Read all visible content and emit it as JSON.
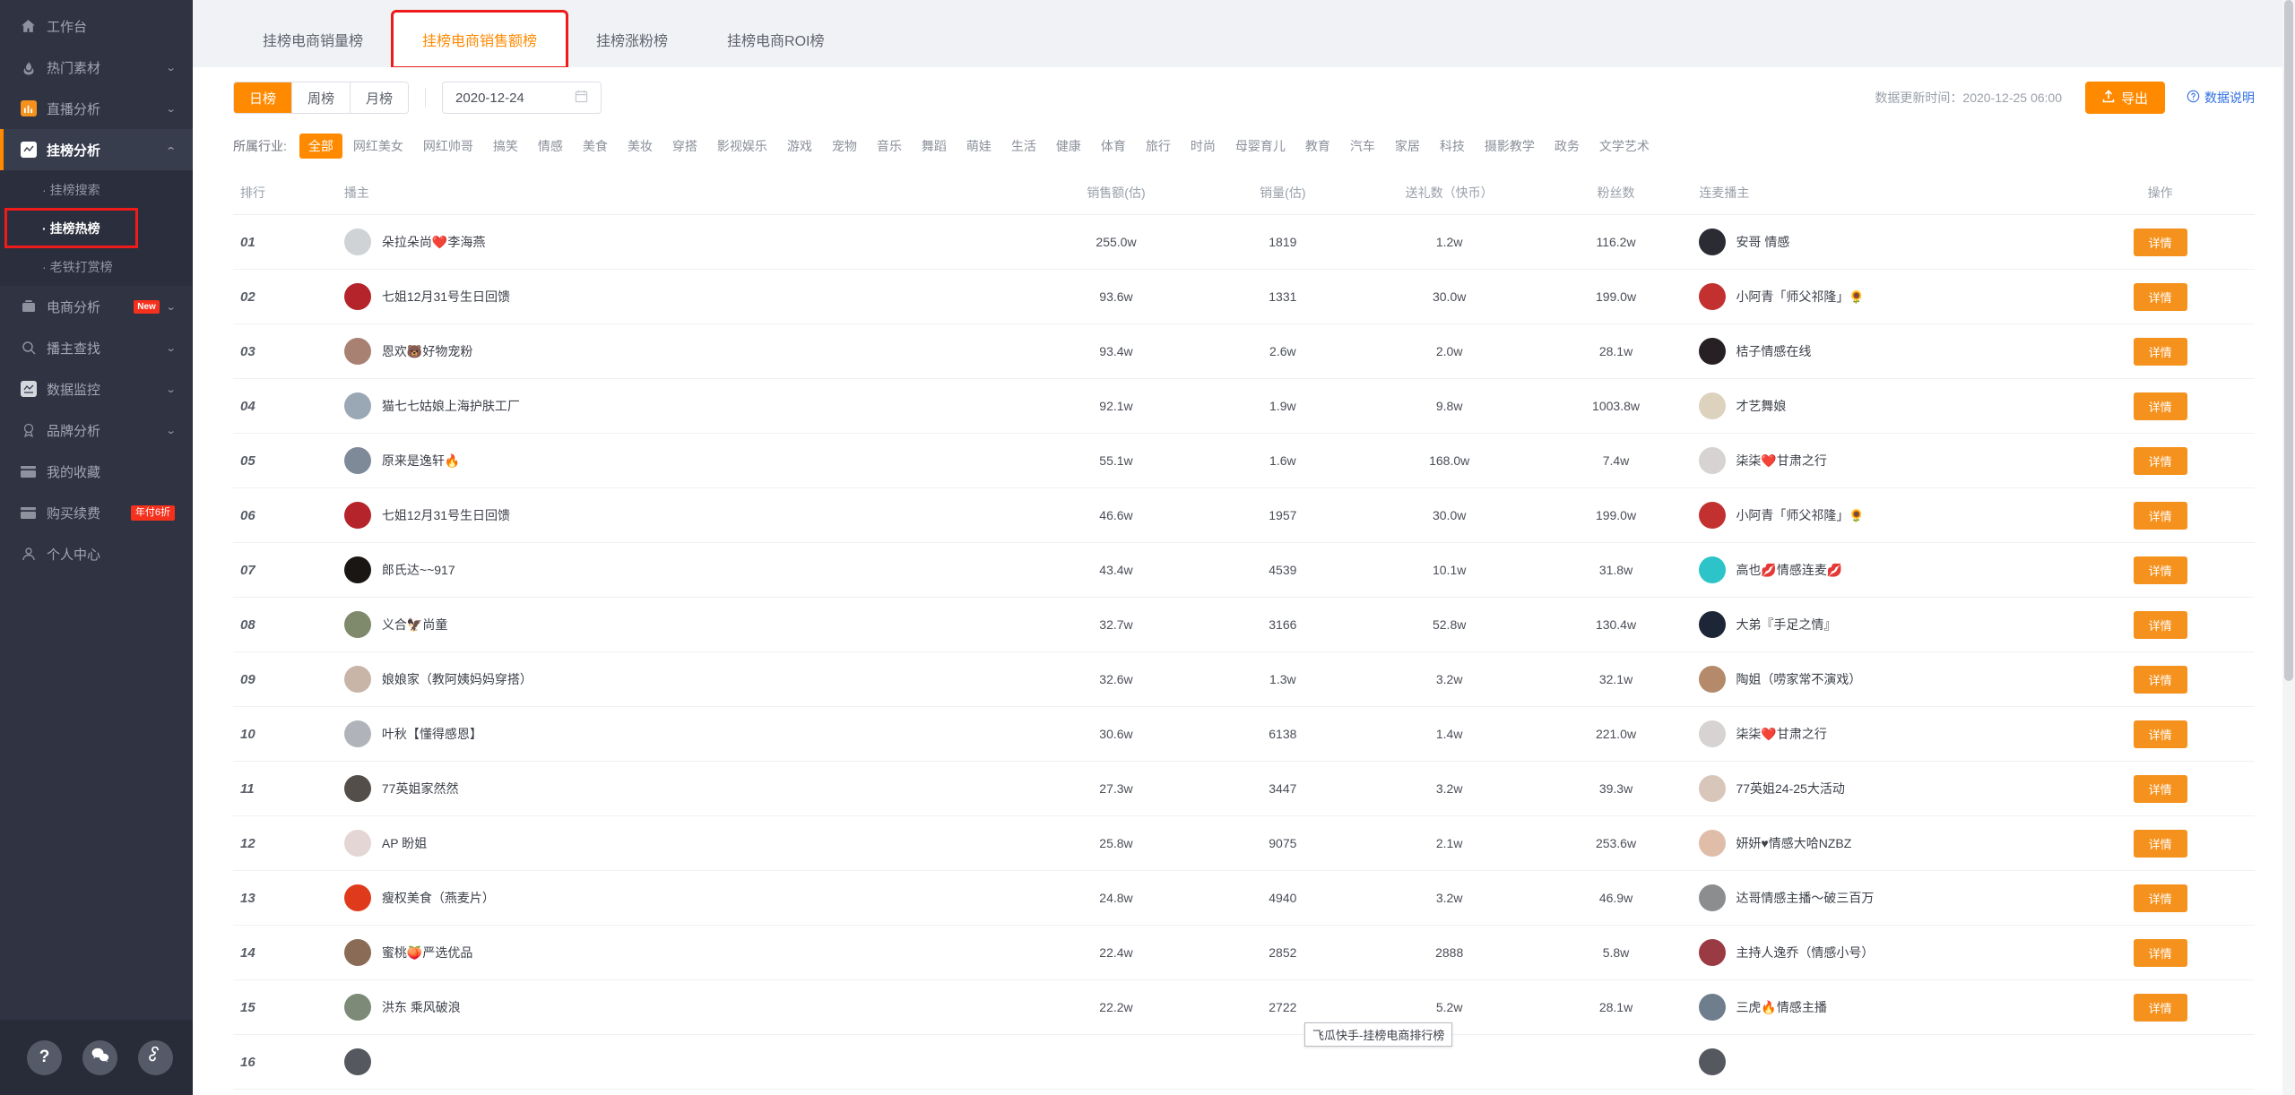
{
  "sidebar": {
    "items": [
      {
        "label": "工作台",
        "icon": "home-icon",
        "expandable": false,
        "active": false
      },
      {
        "label": "热门素材",
        "icon": "fire-icon",
        "expandable": true,
        "active": false
      },
      {
        "label": "直播分析",
        "icon": "bar-chart-icon",
        "expandable": true,
        "active": false
      },
      {
        "label": "挂榜分析",
        "icon": "line-chart-icon",
        "expandable": true,
        "active": true
      }
    ],
    "sub_items": [
      {
        "label": "挂榜搜索",
        "active": false,
        "highlight": false
      },
      {
        "label": "挂榜热榜",
        "active": true,
        "highlight": true
      },
      {
        "label": "老铁打赏榜",
        "active": false,
        "highlight": false
      }
    ],
    "items_after": [
      {
        "label": "电商分析",
        "icon": "briefcase-icon",
        "expandable": true,
        "badge": "New",
        "badge_type": "new"
      },
      {
        "label": "播主查找",
        "icon": "search-icon",
        "expandable": true
      },
      {
        "label": "数据监控",
        "icon": "monitor-icon",
        "expandable": true
      },
      {
        "label": "品牌分析",
        "icon": "medal-icon",
        "expandable": true
      },
      {
        "label": "我的收藏",
        "icon": "card-icon",
        "expandable": false
      },
      {
        "label": "购买续费",
        "icon": "card-icon",
        "expandable": false,
        "badge": "年付6折",
        "badge_type": "off"
      },
      {
        "label": "个人中心",
        "icon": "user-icon",
        "expandable": false
      }
    ],
    "footer_buttons": [
      {
        "name": "help-button",
        "glyph": "?"
      },
      {
        "name": "wechat-button",
        "glyph": "wechat"
      },
      {
        "name": "link-button",
        "glyph": "link"
      }
    ]
  },
  "tabs": [
    {
      "label": "挂榜电商销量榜",
      "active": false,
      "boxed": false
    },
    {
      "label": "挂榜电商销售额榜",
      "active": true,
      "boxed": true
    },
    {
      "label": "挂榜涨粉榜",
      "active": false,
      "boxed": false
    },
    {
      "label": "挂榜电商ROI榜",
      "active": false,
      "boxed": false
    }
  ],
  "filters": {
    "period_options": [
      {
        "label": "日榜",
        "selected": true
      },
      {
        "label": "周榜",
        "selected": false
      },
      {
        "label": "月榜",
        "selected": false
      }
    ],
    "date_value": "2020-12-24",
    "calendar_icon": "calendar-icon",
    "update_time": "数据更新时间：2020-12-25 06:00",
    "export_label": "导出",
    "export_icon": "upload-icon",
    "help_label": "数据说明",
    "help_icon": "question-circle-icon",
    "industry_label": "所属行业:",
    "industries": [
      {
        "label": "全部",
        "selected": true
      },
      {
        "label": "网红美女",
        "selected": false
      },
      {
        "label": "网红帅哥",
        "selected": false
      },
      {
        "label": "搞笑",
        "selected": false
      },
      {
        "label": "情感",
        "selected": false
      },
      {
        "label": "美食",
        "selected": false
      },
      {
        "label": "美妆",
        "selected": false
      },
      {
        "label": "穿搭",
        "selected": false
      },
      {
        "label": "影视娱乐",
        "selected": false
      },
      {
        "label": "游戏",
        "selected": false
      },
      {
        "label": "宠物",
        "selected": false
      },
      {
        "label": "音乐",
        "selected": false
      },
      {
        "label": "舞蹈",
        "selected": false
      },
      {
        "label": "萌娃",
        "selected": false
      },
      {
        "label": "生活",
        "selected": false
      },
      {
        "label": "健康",
        "selected": false
      },
      {
        "label": "体育",
        "selected": false
      },
      {
        "label": "旅行",
        "selected": false
      },
      {
        "label": "时尚",
        "selected": false
      },
      {
        "label": "母婴育儿",
        "selected": false
      },
      {
        "label": "教育",
        "selected": false
      },
      {
        "label": "汽车",
        "selected": false
      },
      {
        "label": "家居",
        "selected": false
      },
      {
        "label": "科技",
        "selected": false
      },
      {
        "label": "摄影教学",
        "selected": false
      },
      {
        "label": "政务",
        "selected": false
      },
      {
        "label": "文学艺术",
        "selected": false
      }
    ]
  },
  "table": {
    "columns": [
      "排行",
      "播主",
      "销售额(估)",
      "销量(估)",
      "送礼数（快币）",
      "粉丝数",
      "连麦播主",
      "操作"
    ],
    "action_label": "详情",
    "rows": [
      {
        "rank": "01",
        "host": "朵拉朵尚❤️李海燕",
        "avatar": "#cfd3d6",
        "sales": "255.0w",
        "volume": "1819",
        "gifts": "1.2w",
        "fans": "116.2w",
        "cohost": "安哥 情感",
        "cohost_avatar": "#2b2b33"
      },
      {
        "rank": "02",
        "host": "七姐12月31号生日回馈",
        "avatar": "#b5232b",
        "sales": "93.6w",
        "volume": "1331",
        "gifts": "30.0w",
        "fans": "199.0w",
        "cohost": "小阿青「师父祁隆」🌻",
        "cohost_avatar": "#c2312f"
      },
      {
        "rank": "03",
        "host": "恩欢🐻好物宠粉",
        "avatar": "#a88172",
        "sales": "93.4w",
        "volume": "2.6w",
        "gifts": "2.0w",
        "fans": "28.1w",
        "cohost": "桔子情感在线",
        "cohost_avatar": "#262024"
      },
      {
        "rank": "04",
        "host": "猫七七姑娘上海护肤工厂",
        "avatar": "#9aa7b4",
        "sales": "92.1w",
        "volume": "1.9w",
        "gifts": "9.8w",
        "fans": "1003.8w",
        "cohost": "才艺舞娘",
        "cohost_avatar": "#ddd2bd"
      },
      {
        "rank": "05",
        "host": "原来是逸轩🔥",
        "avatar": "#7f8a99",
        "sales": "55.1w",
        "volume": "1.6w",
        "gifts": "168.0w",
        "fans": "7.4w",
        "cohost": "柒柒❤️甘肃之行",
        "cohost_avatar": "#d6d3d2"
      },
      {
        "rank": "06",
        "host": "七姐12月31号生日回馈",
        "avatar": "#b5232b",
        "sales": "46.6w",
        "volume": "1957",
        "gifts": "30.0w",
        "fans": "199.0w",
        "cohost": "小阿青「师父祁隆」🌻",
        "cohost_avatar": "#c2312f"
      },
      {
        "rank": "07",
        "host": "郎氏达~~917",
        "avatar": "#191614",
        "sales": "43.4w",
        "volume": "4539",
        "gifts": "10.1w",
        "fans": "31.8w",
        "cohost": "高也💋情感连麦💋",
        "cohost_avatar": "#2cc4c9"
      },
      {
        "rank": "08",
        "host": "义合🦅尚童",
        "avatar": "#7e8a6b",
        "sales": "32.7w",
        "volume": "3166",
        "gifts": "52.8w",
        "fans": "130.4w",
        "cohost": "大弟『手足之情』",
        "cohost_avatar": "#1d2636"
      },
      {
        "rank": "09",
        "host": "娘娘家（教阿姨妈妈穿搭）",
        "avatar": "#c8b5a8",
        "sales": "32.6w",
        "volume": "1.3w",
        "gifts": "3.2w",
        "fans": "32.1w",
        "cohost": "陶姐（唠家常不演戏）",
        "cohost_avatar": "#b48a6b"
      },
      {
        "rank": "10",
        "host": "叶秋【懂得感恩】",
        "avatar": "#b0b4ba",
        "sales": "30.6w",
        "volume": "6138",
        "gifts": "1.4w",
        "fans": "221.0w",
        "cohost": "柒柒❤️甘肃之行",
        "cohost_avatar": "#d6d3d2"
      },
      {
        "rank": "11",
        "host": "77英姐家然然",
        "avatar": "#544e4a",
        "sales": "27.3w",
        "volume": "3447",
        "gifts": "3.2w",
        "fans": "39.3w",
        "cohost": "77英姐24-25大活动",
        "cohost_avatar": "#d9c6bb"
      },
      {
        "rank": "12",
        "host": "AP 盼姐",
        "avatar": "#e4d6d4",
        "sales": "25.8w",
        "volume": "9075",
        "gifts": "2.1w",
        "fans": "253.6w",
        "cohost": "妍妍♥情感大哈NZBZ",
        "cohost_avatar": "#e0bda9"
      },
      {
        "rank": "13",
        "host": "瘦权美食（燕麦片）",
        "avatar": "#e03a1c",
        "sales": "24.8w",
        "volume": "4940",
        "gifts": "3.2w",
        "fans": "46.9w",
        "cohost": "达哥情感主播～破三百万",
        "cohost_avatar": "#8c8d8f"
      },
      {
        "rank": "14",
        "host": "蜜桃🍑严选优品",
        "avatar": "#8a6b55",
        "sales": "22.4w",
        "volume": "2852",
        "gifts": "2888",
        "fans": "5.8w",
        "cohost": "主持人逸乔（情感小号）",
        "cohost_avatar": "#9a3a42"
      },
      {
        "rank": "15",
        "host": "洪东 乘风破浪",
        "avatar": "#7c8a77",
        "sales": "22.2w",
        "volume": "2722",
        "gifts": "5.2w",
        "fans": "28.1w",
        "cohost": "三虎🔥情感主播",
        "cohost_avatar": "#6f7e8c"
      },
      {
        "rank": "16",
        "host": "",
        "avatar": "#55595f",
        "sales": "",
        "volume": "",
        "gifts": "",
        "fans": "",
        "cohost": "",
        "cohost_avatar": "#55595f"
      }
    ]
  },
  "tooltip": {
    "text": "飞瓜快手-挂榜电商排行榜"
  }
}
